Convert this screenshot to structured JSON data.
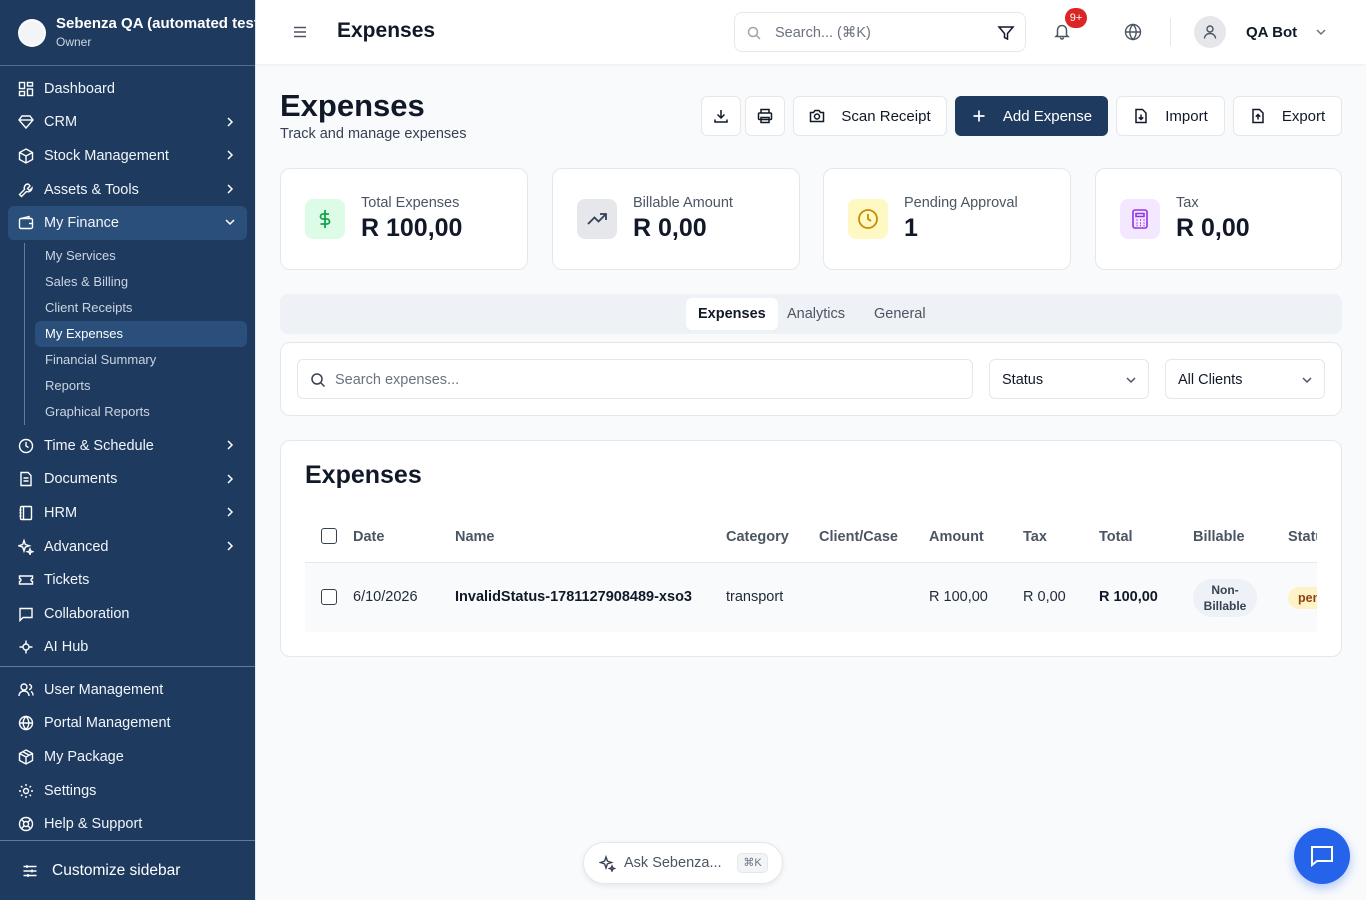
{
  "sidebar": {
    "org_name": "Sebenza QA (automated tests)",
    "org_role": "Owner",
    "items": [
      {
        "label": "Dashboard",
        "icon": "dashboard-icon"
      },
      {
        "label": "CRM",
        "icon": "diamond-icon"
      },
      {
        "label": "Stock Management",
        "icon": "box-icon"
      },
      {
        "label": "Assets & Tools",
        "icon": "wrench-icon"
      },
      {
        "label": "My Finance",
        "icon": "wallet-icon",
        "expanded": true
      },
      {
        "label": "Time & Schedule",
        "icon": "clock-icon"
      },
      {
        "label": "Documents",
        "icon": "document-icon"
      },
      {
        "label": "HRM",
        "icon": "notebook-icon"
      },
      {
        "label": "Advanced",
        "icon": "sparkle-icon"
      },
      {
        "label": "Tickets",
        "icon": "ticket-icon"
      },
      {
        "label": "Collaboration",
        "icon": "message-icon"
      },
      {
        "label": "AI Hub",
        "icon": "ai-icon"
      }
    ],
    "finance_sub": [
      "My Services",
      "Sales & Billing",
      "Client Receipts",
      "My Expenses",
      "Financial Summary",
      "Reports",
      "Graphical Reports"
    ],
    "bottom_items": [
      {
        "label": "User Management",
        "icon": "users-icon"
      },
      {
        "label": "Portal Management",
        "icon": "globe-icon"
      },
      {
        "label": "My Package",
        "icon": "package-icon"
      },
      {
        "label": "Settings",
        "icon": "gear-icon"
      },
      {
        "label": "Help & Support",
        "icon": "help-icon"
      }
    ],
    "customize_label": "Customize sidebar"
  },
  "topbar": {
    "title": "Expenses",
    "search_placeholder": "Search... (⌘K)",
    "notif_badge": "9+",
    "user_name": "QA Bot"
  },
  "page": {
    "title": "Expenses",
    "subtitle": "Track and manage expenses",
    "buttons": {
      "scan": "Scan Receipt",
      "add": "Add Expense",
      "import": "Import",
      "export": "Export"
    }
  },
  "stats": [
    {
      "label": "Total Expenses",
      "value": "R 100,00",
      "color": "#16a34a"
    },
    {
      "label": "Billable Amount",
      "value": "R 0,00",
      "color": "#334155"
    },
    {
      "label": "Pending Approval",
      "value": "1",
      "color": "#ca8a04"
    },
    {
      "label": "Tax",
      "value": "R 0,00",
      "color": "#9333ea"
    }
  ],
  "tabs": [
    "Expenses",
    "Analytics",
    "General"
  ],
  "filters": {
    "search_placeholder": "Search expenses...",
    "status": "Status",
    "clients": "All Clients"
  },
  "table": {
    "title": "Expenses",
    "headers": [
      "Date",
      "Name",
      "Category",
      "Client/Case",
      "Amount",
      "Tax",
      "Total",
      "Billable",
      "Status"
    ],
    "rows": [
      {
        "date": "6/10/2026",
        "name": "InvalidStatus-1781127908489-xso3",
        "category": "transport",
        "client": "",
        "amount": "R 100,00",
        "tax": "R 0,00",
        "total": "R 100,00",
        "billable": "Non-Billable",
        "status": "pending"
      }
    ]
  },
  "assistant": {
    "label": "Ask Sebenza...",
    "shortcut": "⌘K"
  },
  "colors": {
    "sidebar_bg": "#1e3a5f",
    "primary": "#1e3a5f",
    "chat": "#2563eb"
  }
}
